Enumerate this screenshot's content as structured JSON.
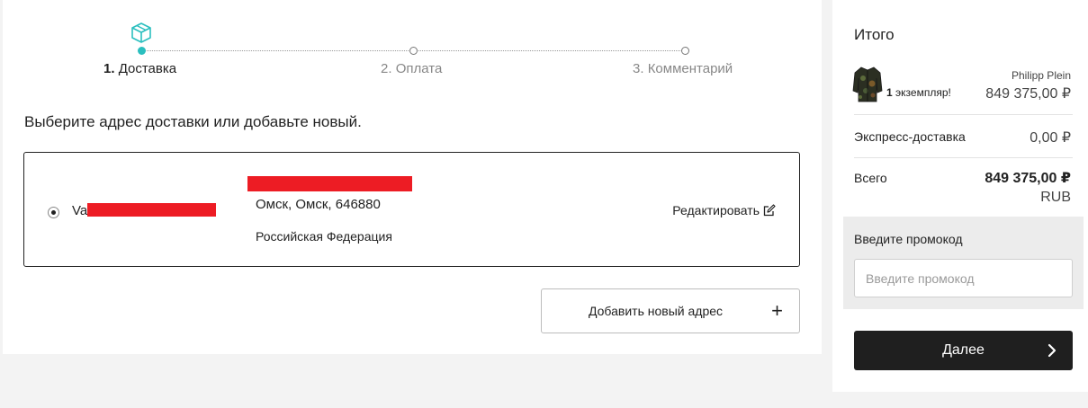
{
  "stepper": {
    "steps": [
      {
        "number": "1.",
        "label": "Доставка",
        "active": true
      },
      {
        "number": "2.",
        "label": "Оплата",
        "active": false
      },
      {
        "number": "3.",
        "label": "Комментарий",
        "active": false
      }
    ],
    "active_icon": "box-icon",
    "accent_color": "#2bbfbf"
  },
  "main": {
    "title": "Выберите адрес доставки или добавьте новый.",
    "address": {
      "name_prefix": "Va",
      "city_line": "Омск, Омск, 646880",
      "country": "Российская Федерация",
      "edit_label": "Редактировать",
      "selected": true
    },
    "add_address_label": "Добавить новый адрес",
    "add_icon": "plus-icon"
  },
  "summary": {
    "title": "Итого",
    "product": {
      "brand": "Philipp Plein",
      "qty_number": "1",
      "qty_text": "экземпляр!",
      "price": "849 375,00 ₽"
    },
    "shipping": {
      "label": "Экспресс-доставка",
      "value": "0,00 ₽"
    },
    "total": {
      "label": "Всего",
      "value": "849 375,00 ₽",
      "currency": "RUB"
    },
    "promo": {
      "label": "Введите промокод",
      "placeholder": "Введите промокод",
      "value": ""
    },
    "next_label": "Далее"
  }
}
